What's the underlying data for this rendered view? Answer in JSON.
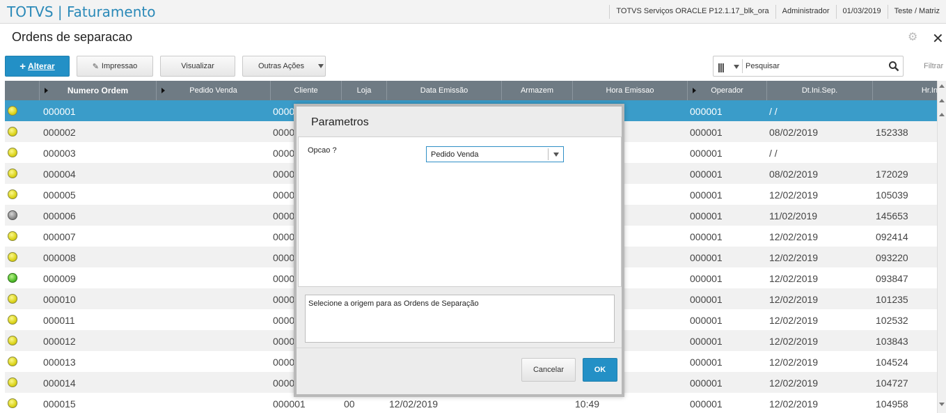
{
  "topbar": {
    "app_title": "TOTVS | Faturamento",
    "environment": "TOTVS Serviços ORACLE P12.1.17_blk_ora",
    "user": "Administrador",
    "date": "01/03/2019",
    "branch": "Teste / Matriz"
  },
  "page": {
    "title": "Ordens de separacao"
  },
  "toolbar": {
    "alterar_label": "Alterar",
    "impressao_label": "Impressao",
    "visualizar_label": "Visualizar",
    "outras_acoes_label": "Outras Ações",
    "search_placeholder": "Pesquisar",
    "filtrar_label": "Filtrar"
  },
  "grid": {
    "columns": [
      "Numero Ordem",
      "Pedido Venda",
      "Cliente",
      "Loja",
      "Data Emissão",
      "Armazem",
      "Hora Emissao",
      "Operador",
      "Dt.Ini.Sep.",
      "Hr.Ini.Se"
    ],
    "rows": [
      {
        "status": "yellow",
        "numero": "000001",
        "cliente": "0000",
        "loja": "",
        "data": "",
        "hora": "",
        "operador": "000001",
        "dt_ini": " /  /",
        "hr_ini": ""
      },
      {
        "status": "yellow",
        "numero": "000002",
        "cliente": "0000",
        "loja": "",
        "data": "",
        "hora": "",
        "operador": "000001",
        "dt_ini": "08/02/2019",
        "hr_ini": "152338"
      },
      {
        "status": "yellow",
        "numero": "000003",
        "cliente": "0000",
        "loja": "",
        "data": "",
        "hora": "",
        "operador": "000001",
        "dt_ini": " /  /",
        "hr_ini": ""
      },
      {
        "status": "yellow",
        "numero": "000004",
        "cliente": "0000",
        "loja": "",
        "data": "",
        "hora": "",
        "operador": "000001",
        "dt_ini": "08/02/2019",
        "hr_ini": "172029"
      },
      {
        "status": "yellow",
        "numero": "000005",
        "cliente": "0000",
        "loja": "",
        "data": "",
        "hora": "",
        "operador": "000001",
        "dt_ini": "12/02/2019",
        "hr_ini": "105039"
      },
      {
        "status": "gray",
        "numero": "000006",
        "cliente": "0000",
        "loja": "",
        "data": "",
        "hora": "",
        "operador": "000001",
        "dt_ini": "11/02/2019",
        "hr_ini": "145653"
      },
      {
        "status": "yellow",
        "numero": "000007",
        "cliente": "0000",
        "loja": "",
        "data": "",
        "hora": "",
        "operador": "000001",
        "dt_ini": "12/02/2019",
        "hr_ini": "092414"
      },
      {
        "status": "yellow",
        "numero": "000008",
        "cliente": "0000",
        "loja": "",
        "data": "",
        "hora": "",
        "operador": "000001",
        "dt_ini": "12/02/2019",
        "hr_ini": "093220"
      },
      {
        "status": "green",
        "numero": "000009",
        "cliente": "0000",
        "loja": "",
        "data": "",
        "hora": "",
        "operador": "000001",
        "dt_ini": "12/02/2019",
        "hr_ini": "093847"
      },
      {
        "status": "yellow",
        "numero": "000010",
        "cliente": "0000",
        "loja": "",
        "data": "",
        "hora": "",
        "operador": "000001",
        "dt_ini": "12/02/2019",
        "hr_ini": "101235"
      },
      {
        "status": "yellow",
        "numero": "000011",
        "cliente": "0000",
        "loja": "",
        "data": "",
        "hora": "",
        "operador": "000001",
        "dt_ini": "12/02/2019",
        "hr_ini": "102532"
      },
      {
        "status": "yellow",
        "numero": "000012",
        "cliente": "0000",
        "loja": "",
        "data": "",
        "hora": "",
        "operador": "000001",
        "dt_ini": "12/02/2019",
        "hr_ini": "103843"
      },
      {
        "status": "yellow",
        "numero": "000013",
        "cliente": "0000",
        "loja": "",
        "data": "",
        "hora": "",
        "operador": "000001",
        "dt_ini": "12/02/2019",
        "hr_ini": "104524"
      },
      {
        "status": "yellow",
        "numero": "000014",
        "cliente": "0000",
        "loja": "",
        "data": "",
        "hora": "",
        "operador": "000001",
        "dt_ini": "12/02/2019",
        "hr_ini": "104727"
      },
      {
        "status": "yellow",
        "numero": "000015",
        "cliente": "000001",
        "loja": "00",
        "data": "12/02/2019",
        "hora": "10:49",
        "operador": "000001",
        "dt_ini": "12/02/2019",
        "hr_ini": "104958"
      }
    ]
  },
  "dialog": {
    "title": "Parametros",
    "opcao_label": "Opcao ?",
    "opcao_value": "Pedido Venda",
    "description": "Selecione a origem para as Ordens de Separação",
    "cancel_label": "Cancelar",
    "ok_label": "OK"
  },
  "colors": {
    "accent": "#2390c6",
    "header_bg": "#6f7b84",
    "selected_row": "#3a9cc9"
  }
}
